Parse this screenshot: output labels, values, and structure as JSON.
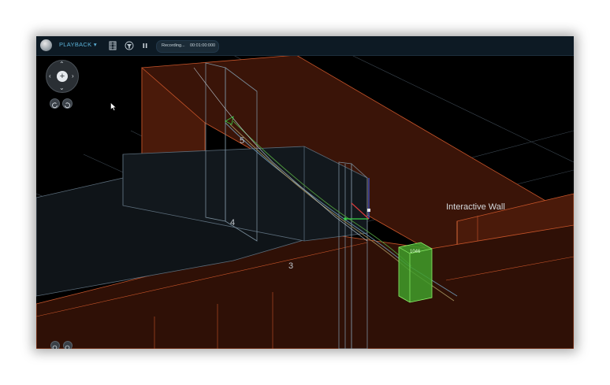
{
  "topbar": {
    "mode_label": "PLAYBACK ▾",
    "recording_label": "Recording...",
    "recording_time": "00:01:00:000",
    "icons": [
      "app-logo-icon",
      "film-strip-icon",
      "filter-icon",
      "pause-icon"
    ]
  },
  "navigation": {
    "icons": [
      "arrow-up-icon",
      "arrow-down-icon",
      "arrow-left-icon",
      "arrow-right-icon",
      "center-home-icon",
      "rotate-left-icon",
      "rotate-right-icon",
      "zoom-in-icon",
      "zoom-out-icon"
    ]
  },
  "scene": {
    "labels": [
      "5",
      "4",
      "3"
    ],
    "wall_label": "Interactive Wall",
    "sensor_label": "1046",
    "colors": {
      "background": "#000000",
      "wall_fill": "#3a1408",
      "wall_edge": "#c8552a",
      "wire": "#6a8ea8",
      "sensor": "#5fcf3d"
    }
  }
}
